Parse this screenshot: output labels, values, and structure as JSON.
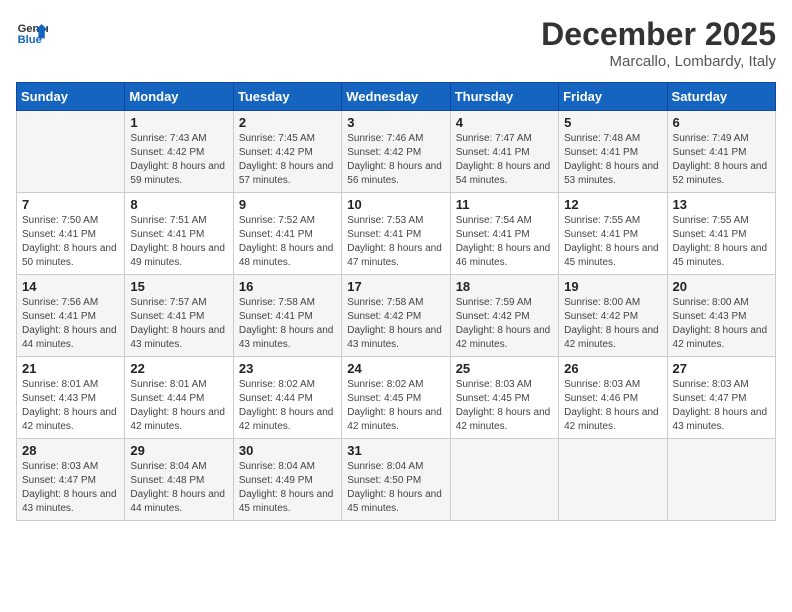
{
  "header": {
    "logo_line1": "General",
    "logo_line2": "Blue",
    "month_year": "December 2025",
    "location": "Marcallo, Lombardy, Italy"
  },
  "days_of_week": [
    "Sunday",
    "Monday",
    "Tuesday",
    "Wednesday",
    "Thursday",
    "Friday",
    "Saturday"
  ],
  "weeks": [
    [
      {
        "day": "",
        "sunrise": "",
        "sunset": "",
        "daylight": ""
      },
      {
        "day": "1",
        "sunrise": "Sunrise: 7:43 AM",
        "sunset": "Sunset: 4:42 PM",
        "daylight": "Daylight: 8 hours and 59 minutes."
      },
      {
        "day": "2",
        "sunrise": "Sunrise: 7:45 AM",
        "sunset": "Sunset: 4:42 PM",
        "daylight": "Daylight: 8 hours and 57 minutes."
      },
      {
        "day": "3",
        "sunrise": "Sunrise: 7:46 AM",
        "sunset": "Sunset: 4:42 PM",
        "daylight": "Daylight: 8 hours and 56 minutes."
      },
      {
        "day": "4",
        "sunrise": "Sunrise: 7:47 AM",
        "sunset": "Sunset: 4:41 PM",
        "daylight": "Daylight: 8 hours and 54 minutes."
      },
      {
        "day": "5",
        "sunrise": "Sunrise: 7:48 AM",
        "sunset": "Sunset: 4:41 PM",
        "daylight": "Daylight: 8 hours and 53 minutes."
      },
      {
        "day": "6",
        "sunrise": "Sunrise: 7:49 AM",
        "sunset": "Sunset: 4:41 PM",
        "daylight": "Daylight: 8 hours and 52 minutes."
      }
    ],
    [
      {
        "day": "7",
        "sunrise": "Sunrise: 7:50 AM",
        "sunset": "Sunset: 4:41 PM",
        "daylight": "Daylight: 8 hours and 50 minutes."
      },
      {
        "day": "8",
        "sunrise": "Sunrise: 7:51 AM",
        "sunset": "Sunset: 4:41 PM",
        "daylight": "Daylight: 8 hours and 49 minutes."
      },
      {
        "day": "9",
        "sunrise": "Sunrise: 7:52 AM",
        "sunset": "Sunset: 4:41 PM",
        "daylight": "Daylight: 8 hours and 48 minutes."
      },
      {
        "day": "10",
        "sunrise": "Sunrise: 7:53 AM",
        "sunset": "Sunset: 4:41 PM",
        "daylight": "Daylight: 8 hours and 47 minutes."
      },
      {
        "day": "11",
        "sunrise": "Sunrise: 7:54 AM",
        "sunset": "Sunset: 4:41 PM",
        "daylight": "Daylight: 8 hours and 46 minutes."
      },
      {
        "day": "12",
        "sunrise": "Sunrise: 7:55 AM",
        "sunset": "Sunset: 4:41 PM",
        "daylight": "Daylight: 8 hours and 45 minutes."
      },
      {
        "day": "13",
        "sunrise": "Sunrise: 7:55 AM",
        "sunset": "Sunset: 4:41 PM",
        "daylight": "Daylight: 8 hours and 45 minutes."
      }
    ],
    [
      {
        "day": "14",
        "sunrise": "Sunrise: 7:56 AM",
        "sunset": "Sunset: 4:41 PM",
        "daylight": "Daylight: 8 hours and 44 minutes."
      },
      {
        "day": "15",
        "sunrise": "Sunrise: 7:57 AM",
        "sunset": "Sunset: 4:41 PM",
        "daylight": "Daylight: 8 hours and 43 minutes."
      },
      {
        "day": "16",
        "sunrise": "Sunrise: 7:58 AM",
        "sunset": "Sunset: 4:41 PM",
        "daylight": "Daylight: 8 hours and 43 minutes."
      },
      {
        "day": "17",
        "sunrise": "Sunrise: 7:58 AM",
        "sunset": "Sunset: 4:42 PM",
        "daylight": "Daylight: 8 hours and 43 minutes."
      },
      {
        "day": "18",
        "sunrise": "Sunrise: 7:59 AM",
        "sunset": "Sunset: 4:42 PM",
        "daylight": "Daylight: 8 hours and 42 minutes."
      },
      {
        "day": "19",
        "sunrise": "Sunrise: 8:00 AM",
        "sunset": "Sunset: 4:42 PM",
        "daylight": "Daylight: 8 hours and 42 minutes."
      },
      {
        "day": "20",
        "sunrise": "Sunrise: 8:00 AM",
        "sunset": "Sunset: 4:43 PM",
        "daylight": "Daylight: 8 hours and 42 minutes."
      }
    ],
    [
      {
        "day": "21",
        "sunrise": "Sunrise: 8:01 AM",
        "sunset": "Sunset: 4:43 PM",
        "daylight": "Daylight: 8 hours and 42 minutes."
      },
      {
        "day": "22",
        "sunrise": "Sunrise: 8:01 AM",
        "sunset": "Sunset: 4:44 PM",
        "daylight": "Daylight: 8 hours and 42 minutes."
      },
      {
        "day": "23",
        "sunrise": "Sunrise: 8:02 AM",
        "sunset": "Sunset: 4:44 PM",
        "daylight": "Daylight: 8 hours and 42 minutes."
      },
      {
        "day": "24",
        "sunrise": "Sunrise: 8:02 AM",
        "sunset": "Sunset: 4:45 PM",
        "daylight": "Daylight: 8 hours and 42 minutes."
      },
      {
        "day": "25",
        "sunrise": "Sunrise: 8:03 AM",
        "sunset": "Sunset: 4:45 PM",
        "daylight": "Daylight: 8 hours and 42 minutes."
      },
      {
        "day": "26",
        "sunrise": "Sunrise: 8:03 AM",
        "sunset": "Sunset: 4:46 PM",
        "daylight": "Daylight: 8 hours and 42 minutes."
      },
      {
        "day": "27",
        "sunrise": "Sunrise: 8:03 AM",
        "sunset": "Sunset: 4:47 PM",
        "daylight": "Daylight: 8 hours and 43 minutes."
      }
    ],
    [
      {
        "day": "28",
        "sunrise": "Sunrise: 8:03 AM",
        "sunset": "Sunset: 4:47 PM",
        "daylight": "Daylight: 8 hours and 43 minutes."
      },
      {
        "day": "29",
        "sunrise": "Sunrise: 8:04 AM",
        "sunset": "Sunset: 4:48 PM",
        "daylight": "Daylight: 8 hours and 44 minutes."
      },
      {
        "day": "30",
        "sunrise": "Sunrise: 8:04 AM",
        "sunset": "Sunset: 4:49 PM",
        "daylight": "Daylight: 8 hours and 45 minutes."
      },
      {
        "day": "31",
        "sunrise": "Sunrise: 8:04 AM",
        "sunset": "Sunset: 4:50 PM",
        "daylight": "Daylight: 8 hours and 45 minutes."
      },
      {
        "day": "",
        "sunrise": "",
        "sunset": "",
        "daylight": ""
      },
      {
        "day": "",
        "sunrise": "",
        "sunset": "",
        "daylight": ""
      },
      {
        "day": "",
        "sunrise": "",
        "sunset": "",
        "daylight": ""
      }
    ]
  ]
}
